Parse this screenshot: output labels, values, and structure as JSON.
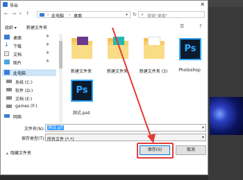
{
  "window": {
    "title": "导出"
  },
  "address": {
    "crumbs": [
      "此电脑",
      "桌面"
    ],
    "search_placeholder": "搜索\"桌面\""
  },
  "toolbar": {
    "organize": "组织 ▾",
    "new_folder": "新建文件夹"
  },
  "sidebar": {
    "items": [
      {
        "label": "桌面",
        "icon": "desktop-icon",
        "pinned": true
      },
      {
        "label": "下载",
        "icon": "download-icon",
        "pinned": true
      },
      {
        "label": "文档",
        "icon": "document-icon",
        "pinned": true
      },
      {
        "label": "图片",
        "icon": "picture-icon",
        "pinned": true
      },
      {
        "label": "此电脑",
        "icon": "computer-icon",
        "pinned": false
      },
      {
        "label": "系统 (C:)",
        "icon": "drive-icon",
        "pinned": false
      },
      {
        "label": "软件 (D:)",
        "icon": "drive-icon",
        "pinned": false
      },
      {
        "label": "文档 (E:)",
        "icon": "drive-icon",
        "pinned": false
      },
      {
        "label": "games (F:)",
        "icon": "drive-icon",
        "pinned": false
      },
      {
        "label": "网络",
        "icon": "network-icon",
        "pinned": false
      }
    ]
  },
  "files": [
    {
      "label": "新建文件夹",
      "kind": "folder"
    },
    {
      "label": "新建文件夹",
      "kind": "folder"
    },
    {
      "label": "新建文件夹 (3)",
      "kind": "folder"
    },
    {
      "label": "Photoshop",
      "kind": "ps"
    },
    {
      "label": "测试.psd",
      "kind": "ps"
    }
  ],
  "form": {
    "filename_label": "文件名(N):",
    "filename_value": "测试.gif",
    "filetype_label": "保存类型(T):",
    "filetype_value": "所有文件 (*.*)"
  },
  "footer": {
    "hide_folders": "隐藏文件夹",
    "save": "保存(S)",
    "cancel": "取消"
  },
  "colors": {
    "accent": "#0078d7",
    "highlight": "#e53935",
    "ps_blue": "#31a8ff"
  }
}
